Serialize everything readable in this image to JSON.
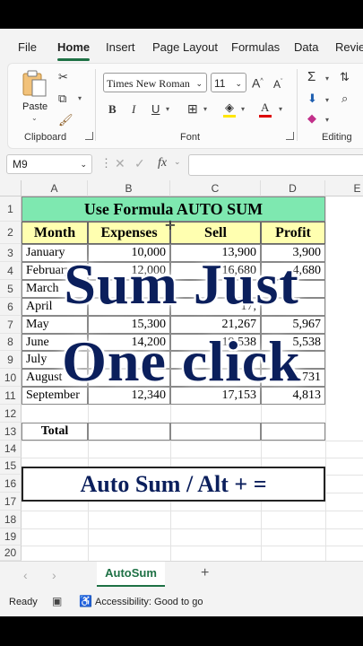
{
  "menu": [
    "File",
    "Home",
    "Insert",
    "Page Layout",
    "Formulas",
    "Data",
    "Review"
  ],
  "active_menu": "Home",
  "clipboard": {
    "paste_label": "Paste",
    "group_label": "Clipboard"
  },
  "font": {
    "name": "Times New Roman",
    "size": "11",
    "group_label": "Font"
  },
  "editing": {
    "group_label": "Editing"
  },
  "formula_bar": {
    "name_box": "M9",
    "fx": "fx",
    "value": ""
  },
  "columns": [
    "A",
    "B",
    "C",
    "D",
    "E"
  ],
  "row_numbers": [
    "1",
    "2",
    "3",
    "4",
    "5",
    "6",
    "7",
    "8",
    "9",
    "10",
    "11",
    "12",
    "13",
    "14",
    "15",
    "16",
    "17",
    "18",
    "19",
    "20"
  ],
  "sheet": {
    "title": "Use Formula  AUTO SUM",
    "headers": [
      "Month",
      "Expenses",
      "Sell",
      "Profit"
    ],
    "rows": [
      {
        "month": "January",
        "expenses": "10,000",
        "sell": "13,900",
        "profit": "3,900"
      },
      {
        "month": "February",
        "expenses": "12,000",
        "sell": "16,680",
        "profit": "4,680"
      },
      {
        "month": "March",
        "expenses": "",
        "sell": "",
        "profit": ""
      },
      {
        "month": "April",
        "expenses": "",
        "sell": "17,",
        "profit": ""
      },
      {
        "month": "May",
        "expenses": "15,300",
        "sell": "21,267",
        "profit": "5,967"
      },
      {
        "month": "June",
        "expenses": "14,200",
        "sell": "19,538",
        "profit": "5,538"
      },
      {
        "month": "July",
        "expenses": "",
        "sell": "",
        "profit": ""
      },
      {
        "month": "August",
        "expenses": "",
        "sell": "",
        "profit": "4,731"
      },
      {
        "month": "September",
        "expenses": "12,340",
        "sell": "17,153",
        "profit": "4,813"
      }
    ],
    "total_label": "Total",
    "shortcut_text": "Auto Sum / Alt + ="
  },
  "overlay": {
    "line1": "Sum Just",
    "line2": "One click"
  },
  "tabs": {
    "sheet_name": "AutoSum",
    "add": "+"
  },
  "status": {
    "ready": "Ready",
    "accessibility": "Accessibility: Good to go"
  },
  "colors": {
    "title_fill": "#7ee8b0",
    "header_fill": "#ffffb0",
    "accent": "#1e7145",
    "overlay_text": "#0b1f5c"
  }
}
